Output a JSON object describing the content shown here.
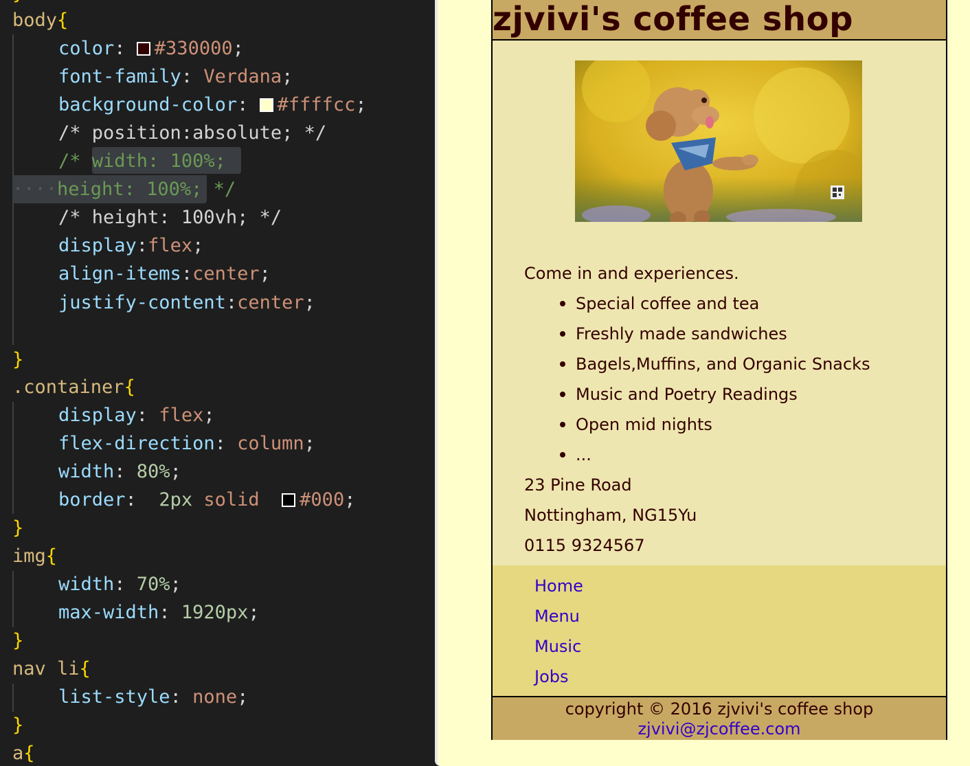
{
  "editor": {
    "lines": {
      "body_sel": "body",
      "color_prop": "color",
      "color_val": "#330000",
      "ff_prop": "font-family",
      "ff_val": "Verdana",
      "bg_prop": "background-color",
      "bg_val": "#ffffcc",
      "c1": "/* position:absolute; */",
      "c2a": "/* ",
      "c2b": "width: 100%;",
      "c3a": "height: 100%;",
      "c3b": " */",
      "c4": "/* height: 100vh; */",
      "disp_prop": "display",
      "disp_val": "flex",
      "ai_prop": "align-items",
      "ai_val": "center",
      "jc_prop": "justify-content",
      "jc_val": "center",
      "container_sel": ".container",
      "c_disp_prop": "display",
      "c_disp_val": "flex",
      "fd_prop": "flex-direction",
      "fd_val": "column",
      "w_prop": "width",
      "w_val": "80%",
      "border_prop": "border",
      "border_num": "2px",
      "border_style": "solid",
      "border_color": "#000",
      "img_sel": "img",
      "iw_prop": "width",
      "iw_val": "70%",
      "mw_prop": "max-width",
      "mw_val": "1920px",
      "nav_sel": "nav li",
      "ls_prop": "list-style",
      "ls_val": "none",
      "a_sel": "a"
    },
    "swatches": {
      "color": "#330000",
      "bg": "#ffffcc",
      "border": "#000000"
    }
  },
  "preview": {
    "title": "zjvivi's coffee shop",
    "intro": "Come in and experiences.",
    "features": [
      "Special coffee and tea",
      "Freshly made sandwiches",
      "Bagels,Muffins, and Organic Snacks",
      "Music and Poetry Readings",
      "Open mid nights",
      "..."
    ],
    "address": [
      "23 Pine Road",
      "Nottingham, NG15Yu",
      "0115 9324567"
    ],
    "nav": [
      "Home",
      "Menu",
      "Music",
      "Jobs"
    ],
    "footer": {
      "copyright": "copyright © 2016 zjvivi's coffee shop",
      "email": "zjvivi@zjcoffee.com"
    },
    "colors": {
      "text": "#330000",
      "background": "#ffffcc",
      "link": "#3300cc",
      "header_bg": "#c8a963",
      "nav_bg": "#e5d880"
    }
  }
}
